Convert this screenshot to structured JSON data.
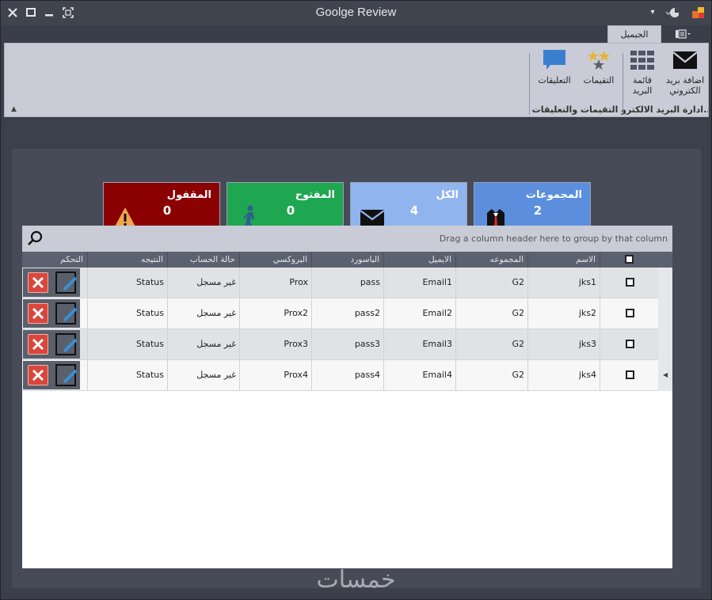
{
  "window": {
    "title": "Goolge Review"
  },
  "ribbon": {
    "home_tab": "الجيميل",
    "groups": [
      {
        "label": "ادارة البريد الالكترو...",
        "buttons": [
          "اضافة بريد الكتروني",
          "قائمة البريد"
        ]
      },
      {
        "label": "التقيمات والتعليقات",
        "buttons": [
          "التقيمات",
          "التعليقات"
        ]
      }
    ]
  },
  "cards": [
    {
      "label": "المجموعات",
      "value": "2",
      "color": "#5b8fdd",
      "icon": "groups-icon"
    },
    {
      "label": "الكل",
      "value": "4",
      "color": "#8fb4ee",
      "icon": "mail-icon"
    },
    {
      "label": "المفتوح",
      "value": "0",
      "color": "#1fa651",
      "icon": "walking-icon"
    },
    {
      "label": "المقفول",
      "value": "0",
      "color": "#8b0000",
      "icon": "warning-icon"
    }
  ],
  "grid": {
    "group_hint": "Drag a column header here to group by that column",
    "columns": [
      "الاسم",
      "المجموعه",
      "الايميل",
      "الباسورد",
      "البروكسي",
      "حالة الحساب",
      "النتيجه",
      "التحكم"
    ],
    "rows": [
      [
        "jks1",
        "G2",
        "Email1",
        "pass",
        "Prox",
        "غير مسجل",
        "Status"
      ],
      [
        "jks2",
        "G2",
        "Email2",
        "pass2",
        "Prox2",
        "غير مسجل",
        "Status"
      ],
      [
        "jks3",
        "G2",
        "Email3",
        "pass3",
        "Prox3",
        "غير مسجل",
        "Status"
      ],
      [
        "jks4",
        "G2",
        "Email4",
        "pass4",
        "Prox4",
        "غير مسجل",
        "Status"
      ]
    ]
  },
  "watermark": "خمسات"
}
